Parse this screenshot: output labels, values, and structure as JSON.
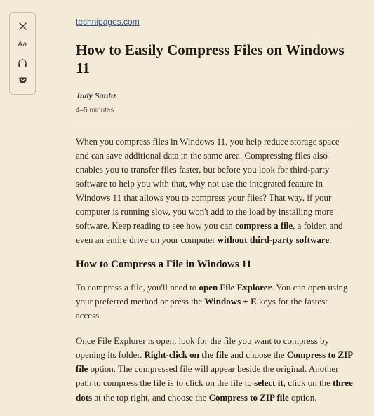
{
  "toolbar": {
    "close_name": "close-icon",
    "font_name": "font-size-icon",
    "font_label": "Aa",
    "listen_name": "headphones-icon",
    "pocket_name": "save-pocket-icon"
  },
  "source": {
    "label": "technipages.com"
  },
  "article": {
    "title": "How to Easily Compress Files on Windows 11",
    "author": "Judy Sanhz",
    "readtime": "4–5 minutes",
    "p1_a": "When you compress files in Windows 11, you help reduce storage space and can save additional data in the same area. Compressing files also enables you to transfer files faster, but before you look for third-party software to help you with that, why not use the integrated feature in Windows 11 that allows you to compress your files? That way, if your computer is running slow, you won't add to the load by installing more software. Keep reading to see how you can ",
    "p1_b1": "compress a file",
    "p1_c": ", a folder, and even an entire drive on your computer ",
    "p1_b2": "without third-party software",
    "p1_d": ".",
    "h2": "How to Compress a File in Windows 11",
    "p2_a": "To compress a file, you'll need to ",
    "p2_b1": "open File Explorer",
    "p2_c": ". You can open using your preferred method or press the ",
    "p2_b2": "Windows + E",
    "p2_d": " keys for the fastest access.",
    "p3_a": "Once File Explorer is open, look for the file you want to compress by opening its folder. ",
    "p3_b1": "Right-click on the file",
    "p3_c": " and choose the ",
    "p3_b2": "Compress to ZIP file",
    "p3_d": " option. The compressed file will appear beside the original. Another path to compress the file is to click on the file to ",
    "p3_b3": "select it",
    "p3_e": ", click on the ",
    "p3_b4": "three dots",
    "p3_f": " at the top right, and choose the ",
    "p3_b5": "Compress to ZIP file",
    "p3_g": " option."
  }
}
